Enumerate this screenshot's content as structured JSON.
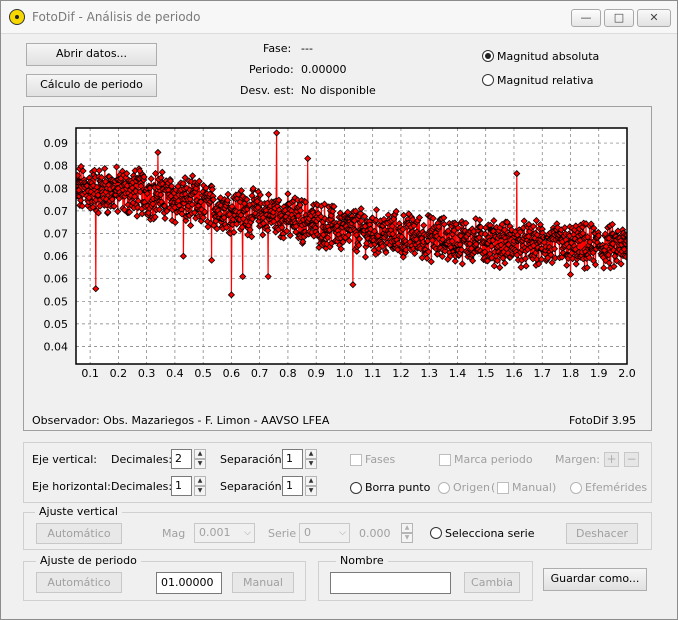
{
  "window": {
    "title": "FotoDif - Análisis de periodo",
    "minimize": "—",
    "maximize": "□",
    "close": "✕"
  },
  "top": {
    "open_button": "Abrir datos...",
    "calc_button": "Cálculo de periodo",
    "fase_label": "Fase:",
    "fase_value": "---",
    "periodo_label": "Periodo:",
    "periodo_value": "0.00000",
    "desv_label": "Desv. est:",
    "desv_value": "No disponible",
    "radio_abs": "Magnitud absoluta",
    "radio_rel": "Magnitud relativa",
    "selected_mode": "Magnitud absoluta"
  },
  "chart_data": {
    "type": "line",
    "marker": "diamond",
    "series_color": "#ff0000",
    "marker_color": "#000000",
    "xlim": [
      0.05,
      2.0
    ],
    "ylim": [
      0.035,
      0.093
    ],
    "x_ticks": [
      "0.1",
      "0.2",
      "0.3",
      "0.4",
      "0.5",
      "0.6",
      "0.7",
      "0.8",
      "0.9",
      "1.0",
      "1.1",
      "1.2",
      "1.3",
      "1.4",
      "1.5",
      "1.6",
      "1.7",
      "1.8",
      "1.9",
      "2.0"
    ],
    "y_ticks": [
      "0.09",
      "0.08",
      "0.08",
      "0.07",
      "0.07",
      "0.06",
      "0.06",
      "0.05",
      "0.05",
      "0.04"
    ],
    "trend": [
      [
        0.05,
        0.078
      ],
      [
        0.3,
        0.077
      ],
      [
        0.5,
        0.074
      ],
      [
        0.8,
        0.071
      ],
      [
        1.0,
        0.068
      ],
      [
        1.3,
        0.066
      ],
      [
        1.6,
        0.0645
      ],
      [
        2.0,
        0.0635
      ]
    ],
    "noise_amplitude": 0.0045,
    "point_count": 1400,
    "outliers": [
      [
        0.12,
        0.0535
      ],
      [
        0.43,
        0.0615
      ],
      [
        0.53,
        0.0605
      ],
      [
        0.6,
        0.052
      ],
      [
        0.64,
        0.0565
      ],
      [
        0.73,
        0.0565
      ],
      [
        0.76,
        0.0918
      ],
      [
        1.03,
        0.0545
      ],
      [
        1.5,
        0.0685
      ],
      [
        1.61,
        0.0395
      ],
      [
        1.61,
        0.0818
      ],
      [
        1.8,
        0.057
      ],
      [
        1.85,
        0.0585
      ],
      [
        0.87,
        0.0855
      ],
      [
        0.34,
        0.087
      ]
    ],
    "grid": true,
    "footer_left": "Observador: Obs. Mazariegos - F. Limon - AAVSO LFEA",
    "footer_right": "FotoDif 3.95"
  },
  "axes_controls": {
    "eje_vertical": "Eje vertical:",
    "eje_horizontal": "Eje horizontal:",
    "decimales": "Decimales:",
    "separacion": "Separación:",
    "v_decimales": "2",
    "v_separacion": "1",
    "h_decimales": "1",
    "h_separacion": "1",
    "fases": "Fases",
    "marca_periodo": "Marca periodo",
    "margen": "Margen:",
    "margen_plus": "+",
    "margen_minus": "−",
    "borra_punto": "Borra punto",
    "origen": "Origen",
    "manual": "Manual)",
    "efemerides": "Efemérides"
  },
  "ajuste_vertical": {
    "title": "Ajuste vertical",
    "auto_button": "Automático",
    "mag_label": "Mag",
    "mag_value": "0.001",
    "serie_label": "Serie",
    "serie_value": "0",
    "offset_value": "0.000",
    "selecciona_serie": "Selecciona serie",
    "deshacer": "Deshacer"
  },
  "ajuste_periodo": {
    "title": "Ajuste de periodo",
    "auto_button": "Automático",
    "period_value": "01.00000",
    "manual_button": "Manual"
  },
  "nombre": {
    "title": "Nombre",
    "value": "",
    "cambia_button": "Cambia"
  },
  "guardar_button": "Guardar como..."
}
